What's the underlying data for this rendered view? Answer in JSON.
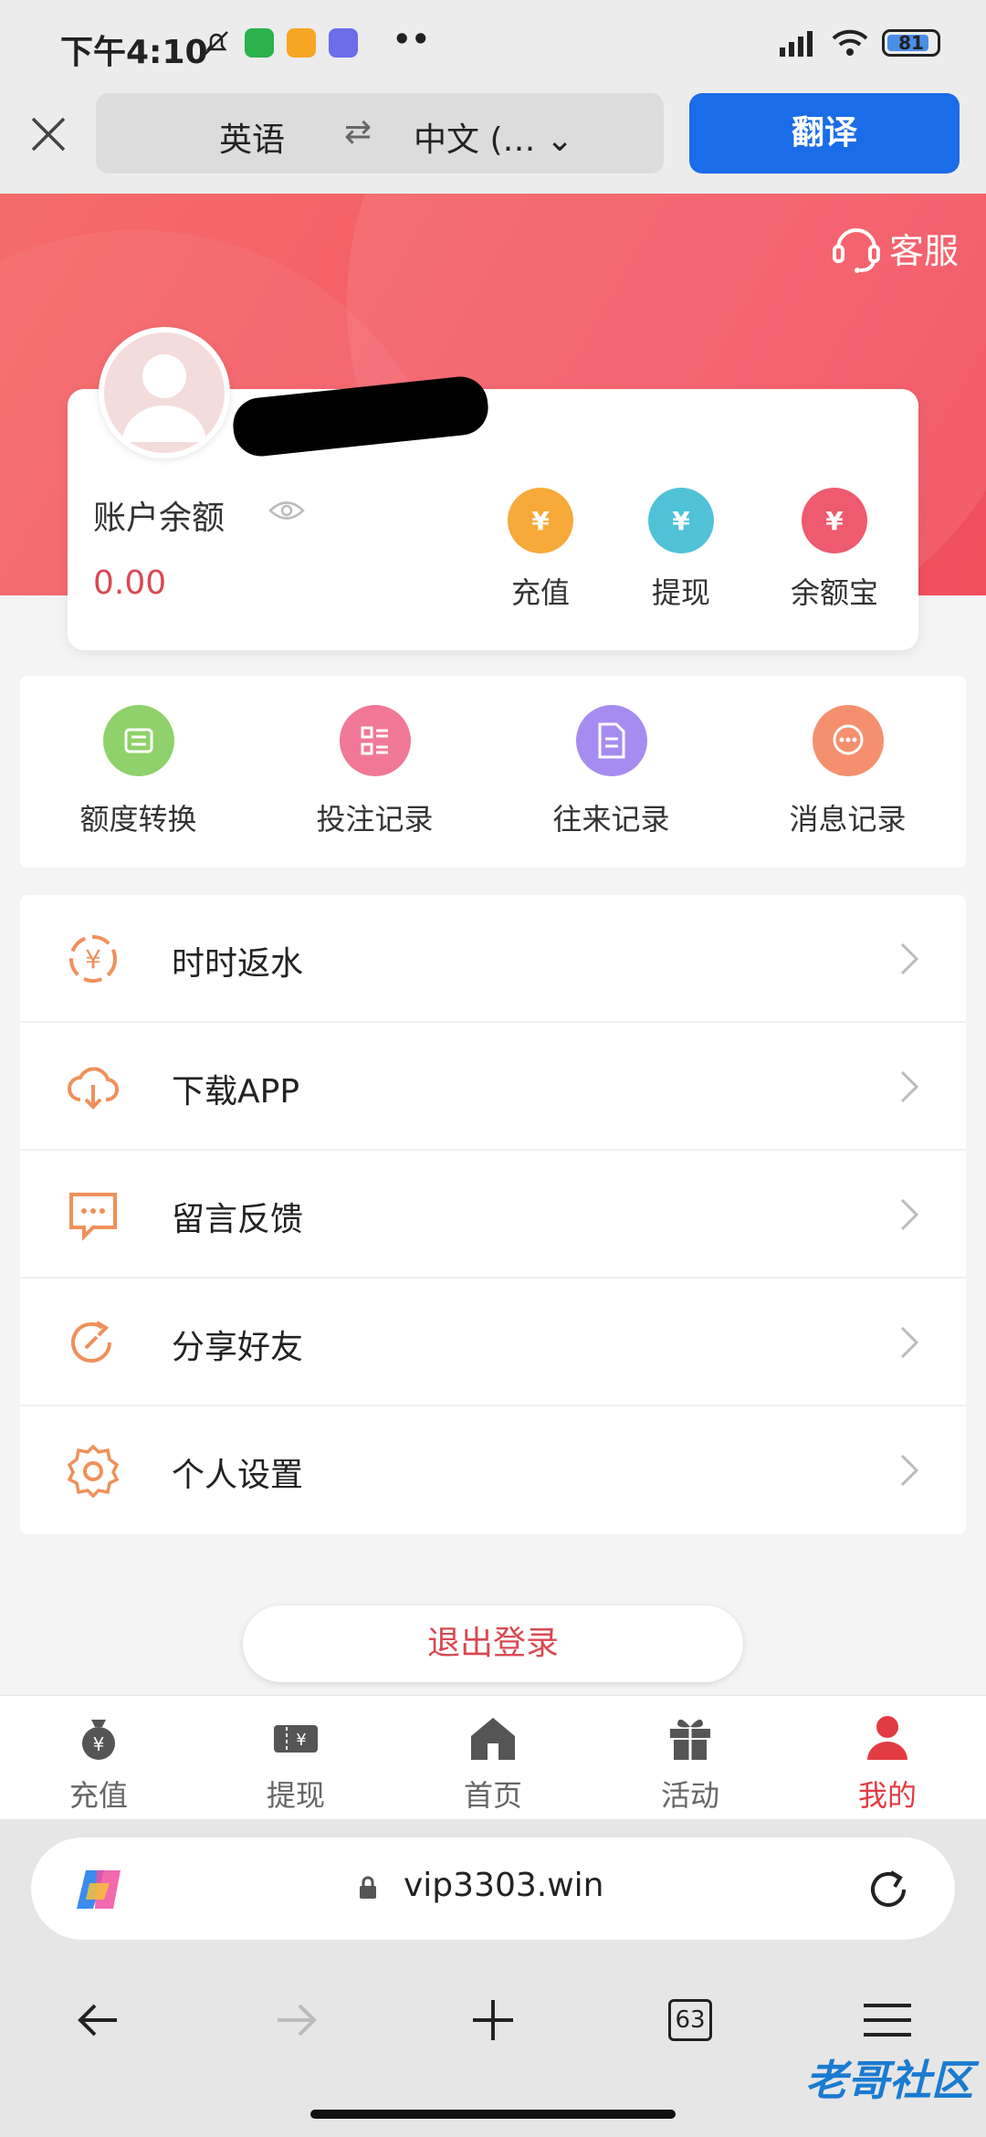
{
  "status_bar": {
    "time": "下午4:10",
    "battery": "81"
  },
  "translate_bar": {
    "source_lang": "英语",
    "target_lang": "中文 (…",
    "translate_label": "翻译"
  },
  "header": {
    "service_label": "客服"
  },
  "account": {
    "balance_label": "账户余额",
    "balance_value": "0.00",
    "actions": [
      {
        "label": "充值",
        "icon": "money-bag-icon",
        "color": "#f7a93a"
      },
      {
        "label": "提现",
        "icon": "hand-yuan-icon",
        "color": "#4fc2d8"
      },
      {
        "label": "余额宝",
        "icon": "treasure-icon",
        "color": "#ee5a6e"
      }
    ]
  },
  "quick_grid": [
    {
      "label": "额度转换",
      "icon": "transfer-icon",
      "color": "#8fd16a"
    },
    {
      "label": "投注记录",
      "icon": "list-icon",
      "color": "#f07896"
    },
    {
      "label": "往来记录",
      "icon": "document-icon",
      "color": "#a68cf0"
    },
    {
      "label": "消息记录",
      "icon": "message-icon",
      "color": "#f5906e"
    }
  ],
  "menu": [
    {
      "label": "时时返水",
      "icon": "rebate-icon"
    },
    {
      "label": "下载APP",
      "icon": "cloud-download-icon"
    },
    {
      "label": "留言反馈",
      "icon": "feedback-icon"
    },
    {
      "label": "分享好友",
      "icon": "share-icon"
    },
    {
      "label": "个人设置",
      "icon": "settings-icon"
    }
  ],
  "logout_label": "退出登录",
  "tabbar": [
    {
      "label": "充值",
      "icon": "money-bag-icon"
    },
    {
      "label": "提现",
      "icon": "ticket-icon"
    },
    {
      "label": "首页",
      "icon": "home-icon"
    },
    {
      "label": "活动",
      "icon": "gift-icon"
    },
    {
      "label": "我的",
      "icon": "user-icon",
      "active": true
    }
  ],
  "browser": {
    "url": "vip3303.win",
    "tab_count": "63"
  },
  "watermark": "老哥社区",
  "colors": {
    "brand_red": "#f45a66",
    "accent_orange": "#f0905a",
    "translate_blue": "#1b6ce8",
    "active_red": "#e23b42"
  }
}
